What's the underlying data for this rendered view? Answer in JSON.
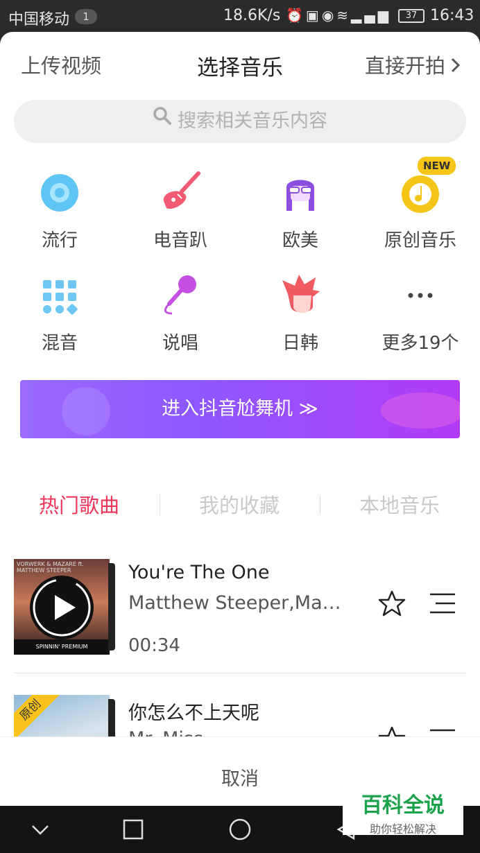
{
  "status": {
    "carrier": "中国移动",
    "sim_badge": "1",
    "speed": "18.6K/s",
    "battery": "37",
    "time": "16:43"
  },
  "header": {
    "upload": "上传视频",
    "title": "选择音乐",
    "shoot": "直接开拍"
  },
  "search": {
    "placeholder": "搜索相关音乐内容"
  },
  "categories": [
    {
      "label": "流行",
      "icon": "vinyl-disc-icon"
    },
    {
      "label": "电音趴",
      "icon": "electric-guitar-icon"
    },
    {
      "label": "欧美",
      "icon": "sunglasses-face-icon"
    },
    {
      "label": "原创音乐",
      "icon": "music-note-disc-icon",
      "badge": "NEW"
    },
    {
      "label": "混音",
      "icon": "grid-dots-icon"
    },
    {
      "label": "说唱",
      "icon": "microphone-icon"
    },
    {
      "label": "日韩",
      "icon": "anime-head-icon"
    },
    {
      "label": "更多19个",
      "icon": "more-dots-icon"
    }
  ],
  "dance_banner": {
    "label": "进入抖音尬舞机"
  },
  "tabs": [
    {
      "label": "热门歌曲",
      "active": true
    },
    {
      "label": "我的收藏",
      "active": false
    },
    {
      "label": "本地音乐",
      "active": false
    }
  ],
  "songs": [
    {
      "title": "You're The One",
      "artist": "Matthew Steeper,Mazar...",
      "duration": "00:34",
      "cover_caption": "VORWERK & MAZARE ft. MATTHEW STEEPER",
      "cover_footer": "SPINNIN' PREMIUM"
    },
    {
      "title": "你怎么不上天呢",
      "artist": "Mr. Miss",
      "ribbon": "原创"
    }
  ],
  "cancel": "取消",
  "watermark": {
    "title": "百科全说",
    "subtitle": "助你轻松解决"
  },
  "colors": {
    "accent": "#f0345a",
    "banner_start": "#9a6bff",
    "banner_end": "#b13bf5",
    "new_badge": "#f5c518"
  }
}
